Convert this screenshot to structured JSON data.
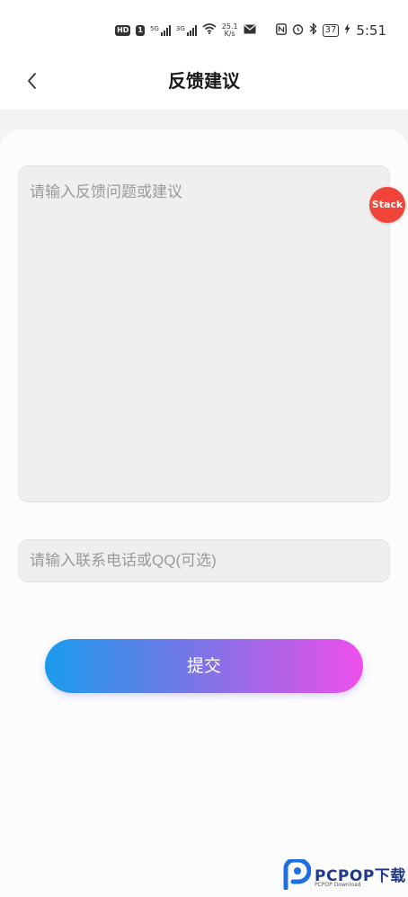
{
  "status_bar": {
    "hd_badge": "HD",
    "sim_badge": "1",
    "signal1_label": "5G",
    "signal2_label": "3G",
    "net_speed_value": "25.1",
    "net_speed_unit": "K/s",
    "battery": "37",
    "time": "5:51"
  },
  "header": {
    "back_icon": "chevron-left-icon",
    "title": "反馈建议"
  },
  "form": {
    "feedback_placeholder": "请输入反馈问题或建议",
    "contact_placeholder": "请输入联系电话或QQ(可选)",
    "submit_label": "提交"
  },
  "floating_badge": {
    "label": "Stack",
    "color": "#f04438"
  },
  "watermark": {
    "brand": "PCPOP下载",
    "sub": "PCPOP Download"
  },
  "colors": {
    "gradient_start": "#1a9bec",
    "gradient_mid": "#8a6fe6",
    "gradient_end": "#ee4fea"
  }
}
